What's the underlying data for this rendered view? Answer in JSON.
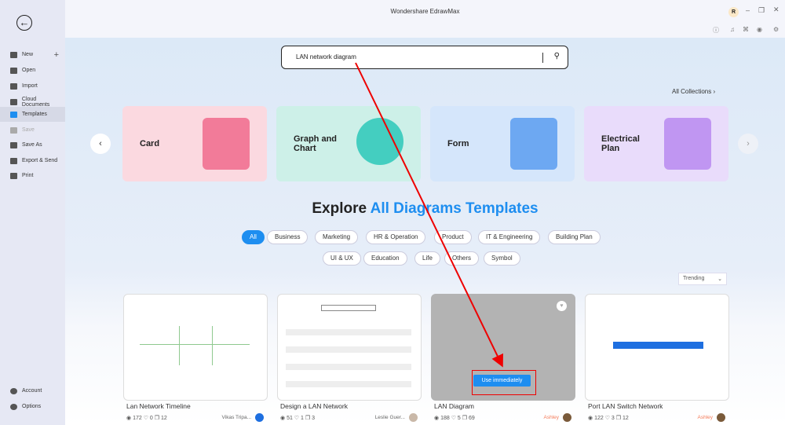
{
  "app": {
    "title": "Wondershare EdrawMax",
    "user_initial": "R"
  },
  "sidebar": {
    "items": [
      {
        "label": "New",
        "icon": "plus-square-icon"
      },
      {
        "label": "Open",
        "icon": "folder-icon"
      },
      {
        "label": "Import",
        "icon": "import-icon"
      },
      {
        "label": "Cloud Documents",
        "icon": "cloud-icon"
      },
      {
        "label": "Templates",
        "icon": "templates-icon",
        "active": true
      },
      {
        "label": "Save",
        "icon": "save-icon",
        "disabled": true
      },
      {
        "label": "Save As",
        "icon": "save-as-icon"
      },
      {
        "label": "Export & Send",
        "icon": "export-icon"
      },
      {
        "label": "Print",
        "icon": "print-icon"
      }
    ],
    "bottom": [
      {
        "label": "Account",
        "icon": "account-icon"
      },
      {
        "label": "Options",
        "icon": "gear-icon"
      }
    ]
  },
  "search": {
    "value": "LAN network diagram"
  },
  "collections": {
    "all_label": "All Collections",
    "cards": [
      {
        "label": "Card",
        "color": "#fbd9e0"
      },
      {
        "label": "Graph and Chart",
        "color": "#cdf0e8"
      },
      {
        "label": "Form",
        "color": "#d5e6fb"
      },
      {
        "label": "Electrical Plan",
        "color": "#e9dcfb"
      }
    ]
  },
  "heading": {
    "part1": "Explore",
    "part2": "All Diagrams Templates"
  },
  "filters": {
    "row1": [
      "All",
      "Business",
      "Marketing",
      "HR & Operation",
      "Product",
      "IT & Engineering",
      "Building Plan"
    ],
    "row2": [
      "UI & UX",
      "Education",
      "Life",
      "Others",
      "Symbol"
    ],
    "active": "All"
  },
  "sort": {
    "value": "Trending"
  },
  "templates": [
    {
      "title": "Lan Network Timeline",
      "views": "172",
      "likes": "0",
      "copies": "12",
      "author": "Vikas Tripa..."
    },
    {
      "title": "Design a LAN Network",
      "views": "51",
      "likes": "1",
      "copies": "3",
      "author": "Leslie Guer..."
    },
    {
      "title": "LAN Diagram",
      "views": "188",
      "likes": "5",
      "copies": "69",
      "author": "Ashley"
    },
    {
      "title": "Port LAN Switch Network",
      "views": "122",
      "likes": "3",
      "copies": "12",
      "author": "Ashley"
    }
  ],
  "hover": {
    "use_label": "Use immediately"
  },
  "colors": {
    "accent": "#1e8ef0",
    "annotation": "#e00000"
  }
}
